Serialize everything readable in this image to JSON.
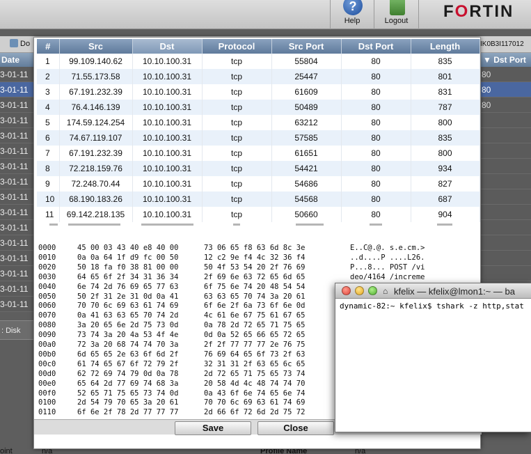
{
  "app": {
    "brand_prefix": "F",
    "brand_rest": "RTIN",
    "brand_o": "O",
    "help_label": "Help",
    "logout_label": "Logout",
    "help_glyph": "?",
    "toolbar_item": "Do",
    "toolbar_id": "IK0B3I117012",
    "date_header": "Date",
    "dst_port_header": "Dst Port",
    "date_rows": [
      "3-01-11",
      "3-01-11",
      "3-01-11",
      "3-01-11",
      "3-01-11",
      "3-01-11",
      "3-01-11",
      "3-01-11",
      "3-01-11",
      "3-01-11",
      "3-01-11",
      "3-01-11",
      "3-01-11",
      "3-01-11",
      "3-01-11",
      "3-01-11"
    ],
    "dst_port_rows": [
      "80",
      "80",
      "80",
      "",
      "",
      "",
      "",
      "",
      "",
      "",
      "",
      "",
      "",
      "",
      "",
      ""
    ],
    "disk_label": ": Disk",
    "bottom_left": "oint",
    "bottom_left_value": "n/a",
    "bottom_mid": "Profile Name",
    "bottom_mid_value": "n/a"
  },
  "packets": {
    "columns": [
      "#",
      "Src",
      "Dst",
      "Protocol",
      "Src Port",
      "Dst Port",
      "Length"
    ],
    "rows": [
      [
        "1",
        "99.109.140.62",
        "10.10.100.31",
        "tcp",
        "55804",
        "80",
        "835"
      ],
      [
        "2",
        "71.55.173.58",
        "10.10.100.31",
        "tcp",
        "25447",
        "80",
        "801"
      ],
      [
        "3",
        "67.191.232.39",
        "10.10.100.31",
        "tcp",
        "61609",
        "80",
        "831"
      ],
      [
        "4",
        "76.4.146.139",
        "10.10.100.31",
        "tcp",
        "50489",
        "80",
        "787"
      ],
      [
        "5",
        "174.59.124.254",
        "10.10.100.31",
        "tcp",
        "63212",
        "80",
        "800"
      ],
      [
        "6",
        "74.67.119.107",
        "10.10.100.31",
        "tcp",
        "57585",
        "80",
        "835"
      ],
      [
        "7",
        "67.191.232.39",
        "10.10.100.31",
        "tcp",
        "61651",
        "80",
        "800"
      ],
      [
        "8",
        "72.218.159.76",
        "10.10.100.31",
        "tcp",
        "54421",
        "80",
        "934"
      ],
      [
        "9",
        "72.248.70.44",
        "10.10.100.31",
        "tcp",
        "54686",
        "80",
        "827"
      ],
      [
        "10",
        "68.190.183.26",
        "10.10.100.31",
        "tcp",
        "54568",
        "80",
        "687"
      ],
      [
        "11",
        "69.142.218.135",
        "10.10.100.31",
        "tcp",
        "50660",
        "80",
        "904"
      ]
    ]
  },
  "hex": [
    {
      "off": "0000",
      "b1": "45 00 03 43 40 e8 40 00",
      "b2": "73 06 65 f8 63 6d 8c 3e",
      "ascii": "E..C@.@. s.e.cm.>"
    },
    {
      "off": "0010",
      "b1": "0a 0a 64 1f d9 fc 00 50",
      "b2": "12 c2 9e f4 4c 32 36 f4",
      "ascii": "..d....P ....L26."
    },
    {
      "off": "0020",
      "b1": "50 18 fa f0 38 81 00 00",
      "b2": "50 4f 53 54 20 2f 76 69",
      "ascii": "P...8... POST /vi"
    },
    {
      "off": "0030",
      "b1": "64 65 6f 2f 34 31 36 34",
      "b2": "2f 69 6e 63 72 65 6d 65",
      "ascii": "deo/4164 /increme"
    },
    {
      "off": "0040",
      "b1": "6e 74 2d 76 69 65 77 63",
      "b2": "6f 75 6e 74 20 48 54 54",
      "ascii": ""
    },
    {
      "off": "0050",
      "b1": "50 2f 31 2e 31 0d 0a 41",
      "b2": "63 63 65 70 74 3a 20 61",
      "ascii": ""
    },
    {
      "off": "0060",
      "b1": "70 70 6c 69 63 61 74 69",
      "b2": "6f 6e 2f 6a 73 6f 6e 0d",
      "ascii": ""
    },
    {
      "off": "0070",
      "b1": "0a 41 63 63 65 70 74 2d",
      "b2": "4c 61 6e 67 75 61 67 65",
      "ascii": ""
    },
    {
      "off": "0080",
      "b1": "3a 20 65 6e 2d 75 73 0d",
      "b2": "0a 78 2d 72 65 71 75 65",
      "ascii": ""
    },
    {
      "off": "0090",
      "b1": "73 74 3a 20 4a 53 4f 4e",
      "b2": "0d 0a 52 65 66 65 72 65",
      "ascii": ""
    },
    {
      "off": "00a0",
      "b1": "72 3a 20 68 74 74 70 3a",
      "b2": "2f 2f 77 77 77 2e 76 75",
      "ascii": ""
    },
    {
      "off": "00b0",
      "b1": "6d 65 65 2e 63 6f 6d 2f",
      "b2": "76 69 64 65 6f 73 2f 63",
      "ascii": ""
    },
    {
      "off": "00c0",
      "b1": "61 74 65 67 6f 72 79 2f",
      "b2": "32 31 31 2f 63 65 6c 65",
      "ascii": ""
    },
    {
      "off": "00d0",
      "b1": "62 72 69 74 79 0d 0a 78",
      "b2": "2d 72 65 71 75 65 73 74",
      "ascii": ""
    },
    {
      "off": "00e0",
      "b1": "65 64 2d 77 69 74 68 3a",
      "b2": "20 58 4d 4c 48 74 74 70",
      "ascii": ""
    },
    {
      "off": "00f0",
      "b1": "52 65 71 75 65 73 74 0d",
      "b2": "0a 43 6f 6e 74 65 6e 74",
      "ascii": ""
    },
    {
      "off": "0100",
      "b1": "2d 54 79 70 65 3a 20 61",
      "b2": "70 70 6c 69 63 61 74 69",
      "ascii": ""
    },
    {
      "off": "0110",
      "b1": "6f 6e 2f 78 2d 77 77 77",
      "b2": "2d 66 6f 72 6d 2d 75 72",
      "ascii": ""
    }
  ],
  "buttons": {
    "save": "Save",
    "close": "Close"
  },
  "terminal": {
    "title": "kfelix — kfelix@lmon1:~ — ba",
    "prompt_line": "dynamic-82:~ kfelix$ tshark -z http,stat"
  },
  "colors": {
    "header_blue": "#6f89a8",
    "row_alt": "#e9f1fa",
    "selection_blue": "#4a67a0"
  }
}
